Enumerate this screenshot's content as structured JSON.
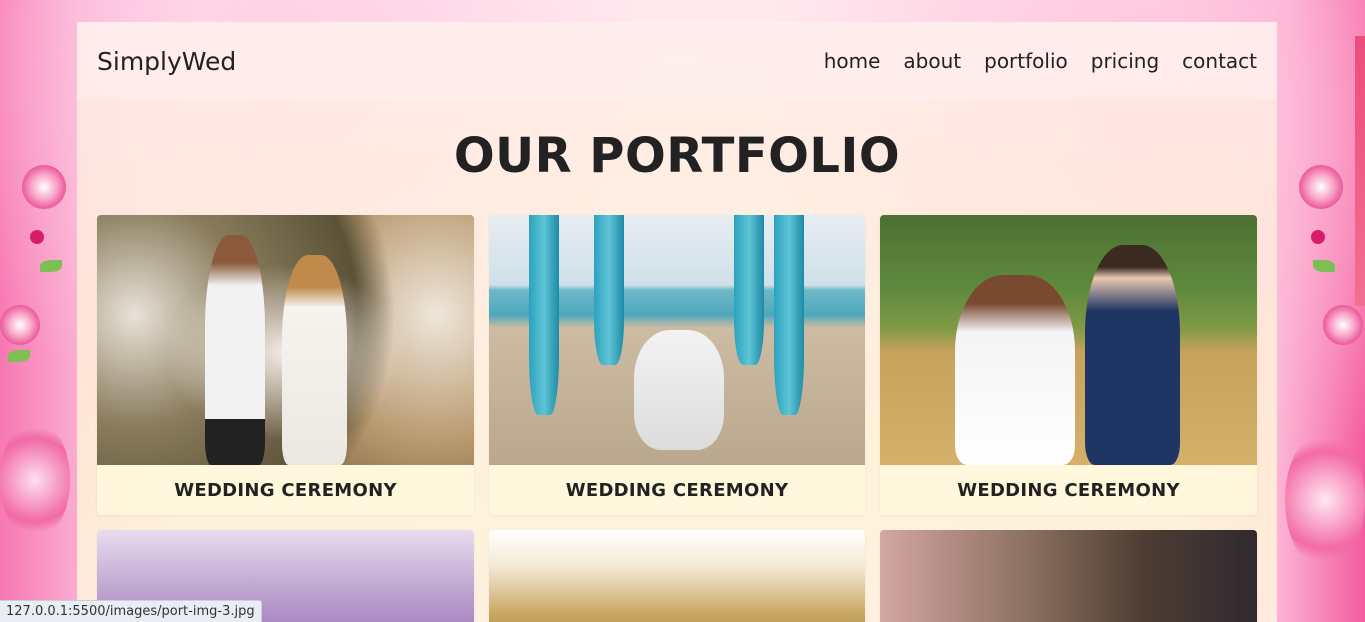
{
  "navbar": {
    "brand": "SimplyWed",
    "links": [
      "home",
      "about",
      "portfolio",
      "pricing",
      "contact"
    ]
  },
  "section": {
    "heading": "OUR PORTFOLIO"
  },
  "portfolio": {
    "cards": [
      {
        "caption": "WEDDING CEREMONY"
      },
      {
        "caption": "WEDDING CEREMONY"
      },
      {
        "caption": "WEDDING CEREMONY"
      },
      {
        "caption": ""
      },
      {
        "caption": ""
      },
      {
        "caption": ""
      }
    ]
  },
  "status_bar": {
    "url": "127.0.0.1:5500/images/port-img-3.jpg"
  },
  "colors": {
    "accent_pink": "#f35c9e",
    "text_dark": "#222222",
    "scroll_strip": "#ec4d7c"
  }
}
